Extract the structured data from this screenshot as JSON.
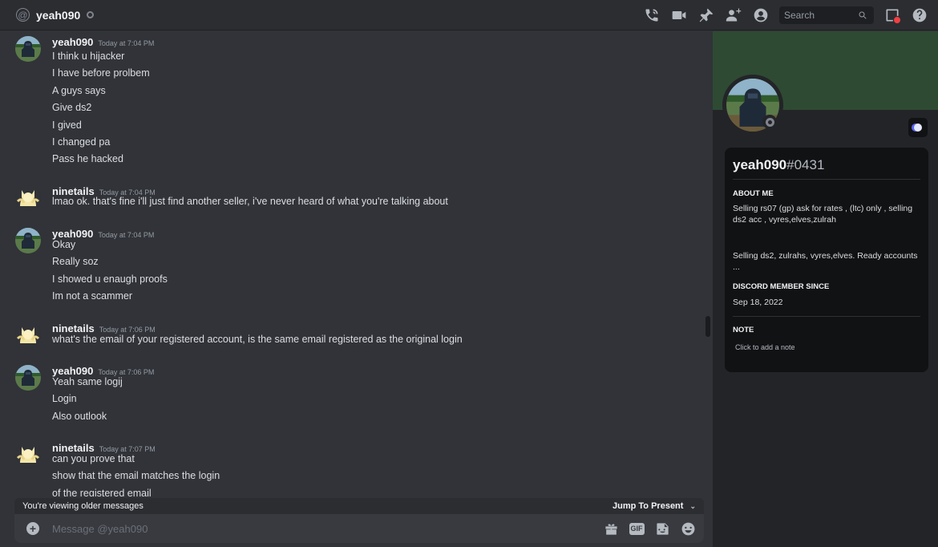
{
  "header": {
    "username": "yeah090",
    "search_placeholder": "Search",
    "icons": [
      "at-icon",
      "status-offline-icon",
      "call-icon",
      "video-icon",
      "pin-icon",
      "add-friend-icon",
      "profile-toggle-icon",
      "search-icon",
      "inbox-icon",
      "help-icon"
    ]
  },
  "messages": [
    {
      "author": "yeah090",
      "timestamp": "Today at 7:04 PM",
      "avatar": "knight-avatar",
      "lines": [
        "I think u hijacker",
        "I have before prolbem",
        "A guys says",
        "Give ds2",
        "I gived",
        "I changed pa",
        "Pass he hacked"
      ]
    },
    {
      "author": "ninetails",
      "timestamp": "Today at 7:04 PM",
      "avatar": "fox-avatar",
      "lines": [
        "lmao ok. that's fine i'll just find another seller, i've never heard of what you're talking about"
      ]
    },
    {
      "author": "yeah090",
      "timestamp": "Today at 7:04 PM",
      "avatar": "knight-avatar",
      "lines": [
        "Okay",
        "Really soz",
        "I showed u enaugh proofs",
        "Im not a scammer"
      ]
    },
    {
      "author": "ninetails",
      "timestamp": "Today at 7:06 PM",
      "avatar": "fox-avatar",
      "lines": [
        "what's the email of your registered account, is the same email registered as the original login"
      ]
    },
    {
      "author": "yeah090",
      "timestamp": "Today at 7:06 PM",
      "avatar": "knight-avatar",
      "lines": [
        "Yeah same logij",
        "Login",
        "Also outlook"
      ]
    },
    {
      "author": "ninetails",
      "timestamp": "Today at 7:07 PM",
      "avatar": "fox-avatar",
      "lines": [
        "can you prove that",
        "show that the email matches the login",
        "of the registered email"
      ]
    }
  ],
  "older_bar": {
    "notice": "You're viewing older messages",
    "jump": "Jump To Present"
  },
  "composer": {
    "placeholder": "Message @yeah090",
    "gif_label": "GIF"
  },
  "profile": {
    "name": "yeah090",
    "discriminator": "#0431",
    "about_title": "ABOUT ME",
    "about_text_1": "Selling rs07 (gp) ask for rates , (ltc) only , selling ds2 acc , vyres,elves,zulrah",
    "about_text_2": "Selling ds2, zulrahs, vyres,elves. Ready accounts ...",
    "member_title": "DISCORD MEMBER SINCE",
    "member_date": "Sep 18, 2022",
    "note_title": "NOTE",
    "note_placeholder": "Click to add a note"
  },
  "colors": {
    "background": "#313338",
    "header": "#2b2d31",
    "panel": "#232428",
    "card": "#111214",
    "banner": "#2e4a33"
  }
}
